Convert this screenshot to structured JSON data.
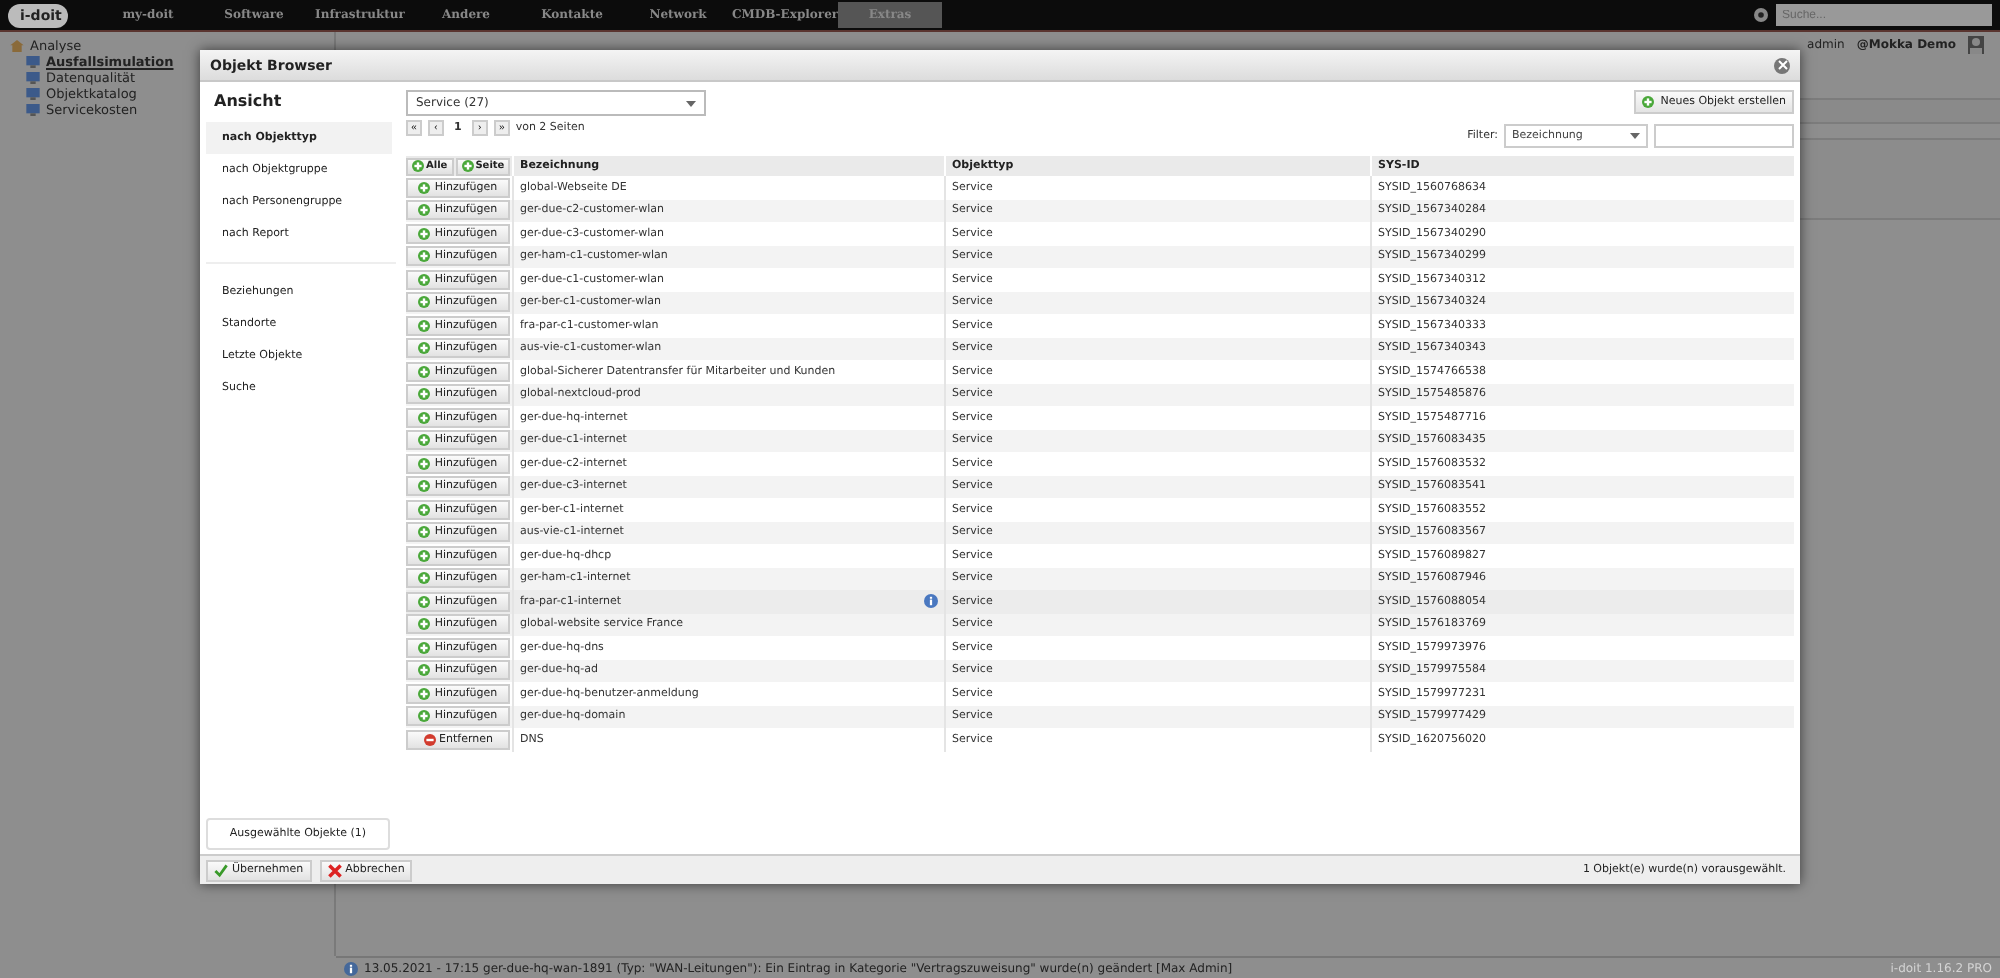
{
  "nav": {
    "logo": "i-doit",
    "items": [
      {
        "label": "my-doit",
        "selected": false
      },
      {
        "label": "Software",
        "selected": false
      },
      {
        "label": "Infrastruktur",
        "selected": false
      },
      {
        "label": "Andere",
        "selected": false
      },
      {
        "label": "Kontakte",
        "selected": false
      },
      {
        "label": "Network",
        "selected": false
      },
      {
        "label": "CMDB-Explorer",
        "selected": false
      },
      {
        "label": "Extras",
        "selected": true
      }
    ],
    "search": {
      "placeholder": "Suche..."
    }
  },
  "user": {
    "name": "admin",
    "tenant": "@Mokka Demo"
  },
  "tree": {
    "items": [
      {
        "label": "Analyse",
        "selected": false,
        "children": [
          {
            "label": "Ausfallsimulation",
            "selected": true
          },
          {
            "label": "Datenqualität",
            "selected": false
          },
          {
            "label": "Objektkatalog",
            "selected": false
          },
          {
            "label": "Servicekosten",
            "selected": false
          }
        ]
      }
    ]
  },
  "dialog": {
    "title": "Objekt Browser",
    "sidebar": {
      "title": "Ansicht",
      "views": [
        {
          "label": "nach Objekttyp",
          "selected": true
        },
        {
          "label": "nach Objektgruppe",
          "selected": false
        },
        {
          "label": "nach Personengruppe",
          "selected": false
        },
        {
          "label": "nach Report",
          "selected": false
        }
      ],
      "links": [
        "Beziehungen",
        "Standorte",
        "Letzte Objekte",
        "Suche"
      ],
      "selected_button": "Ausgewählte Objekte (1)"
    },
    "type_select": "Service (27)",
    "pagination": {
      "first": "«",
      "prev": "‹",
      "page": "1",
      "next": "›",
      "last": "»",
      "pages_text": "von 2 Seiten"
    },
    "new_button": "Neues Objekt erstellen",
    "filter": {
      "label": "Filter:",
      "field": "Bezeichnung"
    },
    "table": {
      "header_buttons": [
        "Alle",
        "Seite"
      ],
      "columns": [
        "Bezeichnung",
        "Objekttyp",
        "SYS-ID"
      ],
      "rows": [
        {
          "action": {
            "kind": "add",
            "label": "Hinzufügen"
          },
          "name": "global-Webseite DE",
          "info": false,
          "type": "Service",
          "sysid": "SYSID_1560768634"
        },
        {
          "action": {
            "kind": "add",
            "label": "Hinzufügen"
          },
          "name": "ger-due-c2-customer-wlan",
          "info": false,
          "type": "Service",
          "sysid": "SYSID_1567340284"
        },
        {
          "action": {
            "kind": "add",
            "label": "Hinzufügen"
          },
          "name": "ger-due-c3-customer-wlan",
          "info": false,
          "type": "Service",
          "sysid": "SYSID_1567340290"
        },
        {
          "action": {
            "kind": "add",
            "label": "Hinzufügen"
          },
          "name": "ger-ham-c1-customer-wlan",
          "info": false,
          "type": "Service",
          "sysid": "SYSID_1567340299"
        },
        {
          "action": {
            "kind": "add",
            "label": "Hinzufügen"
          },
          "name": "ger-due-c1-customer-wlan",
          "info": false,
          "type": "Service",
          "sysid": "SYSID_1567340312"
        },
        {
          "action": {
            "kind": "add",
            "label": "Hinzufügen"
          },
          "name": "ger-ber-c1-customer-wlan",
          "info": false,
          "type": "Service",
          "sysid": "SYSID_1567340324"
        },
        {
          "action": {
            "kind": "add",
            "label": "Hinzufügen"
          },
          "name": "fra-par-c1-customer-wlan",
          "info": false,
          "type": "Service",
          "sysid": "SYSID_1567340333"
        },
        {
          "action": {
            "kind": "add",
            "label": "Hinzufügen"
          },
          "name": "aus-vie-c1-customer-wlan",
          "info": false,
          "type": "Service",
          "sysid": "SYSID_1567340343"
        },
        {
          "action": {
            "kind": "add",
            "label": "Hinzufügen"
          },
          "name": "global-Sicherer Datentransfer für Mitarbeiter und Kunden",
          "info": false,
          "type": "Service",
          "sysid": "SYSID_1574766538"
        },
        {
          "action": {
            "kind": "add",
            "label": "Hinzufügen"
          },
          "name": "global-nextcloud-prod",
          "info": false,
          "type": "Service",
          "sysid": "SYSID_1575485876"
        },
        {
          "action": {
            "kind": "add",
            "label": "Hinzufügen"
          },
          "name": "ger-due-hq-internet",
          "info": false,
          "type": "Service",
          "sysid": "SYSID_1575487716"
        },
        {
          "action": {
            "kind": "add",
            "label": "Hinzufügen"
          },
          "name": "ger-due-c1-internet",
          "info": false,
          "type": "Service",
          "sysid": "SYSID_1576083435"
        },
        {
          "action": {
            "kind": "add",
            "label": "Hinzufügen"
          },
          "name": "ger-due-c2-internet",
          "info": false,
          "type": "Service",
          "sysid": "SYSID_1576083532"
        },
        {
          "action": {
            "kind": "add",
            "label": "Hinzufügen"
          },
          "name": "ger-due-c3-internet",
          "info": false,
          "type": "Service",
          "sysid": "SYSID_1576083541"
        },
        {
          "action": {
            "kind": "add",
            "label": "Hinzufügen"
          },
          "name": "ger-ber-c1-internet",
          "info": false,
          "type": "Service",
          "sysid": "SYSID_1576083552"
        },
        {
          "action": {
            "kind": "add",
            "label": "Hinzufügen"
          },
          "name": "aus-vie-c1-internet",
          "info": false,
          "type": "Service",
          "sysid": "SYSID_1576083567"
        },
        {
          "action": {
            "kind": "add",
            "label": "Hinzufügen"
          },
          "name": "ger-due-hq-dhcp",
          "info": false,
          "type": "Service",
          "sysid": "SYSID_1576089827"
        },
        {
          "action": {
            "kind": "add",
            "label": "Hinzufügen"
          },
          "name": "ger-ham-c1-internet",
          "info": false,
          "type": "Service",
          "sysid": "SYSID_1576087946"
        },
        {
          "action": {
            "kind": "add",
            "label": "Hinzufügen"
          },
          "name": "fra-par-c1-internet",
          "info": true,
          "type": "Service",
          "sysid": "SYSID_1576088054"
        },
        {
          "action": {
            "kind": "add",
            "label": "Hinzufügen"
          },
          "name": "global-website service France",
          "info": false,
          "type": "Service",
          "sysid": "SYSID_1576183769"
        },
        {
          "action": {
            "kind": "add",
            "label": "Hinzufügen"
          },
          "name": "ger-due-hq-dns",
          "info": false,
          "type": "Service",
          "sysid": "SYSID_1579973976"
        },
        {
          "action": {
            "kind": "add",
            "label": "Hinzufügen"
          },
          "name": "ger-due-hq-ad",
          "info": false,
          "type": "Service",
          "sysid": "SYSID_1579975584"
        },
        {
          "action": {
            "kind": "add",
            "label": "Hinzufügen"
          },
          "name": "ger-due-hq-benutzer-anmeldung",
          "info": false,
          "type": "Service",
          "sysid": "SYSID_1579977231"
        },
        {
          "action": {
            "kind": "add",
            "label": "Hinzufügen"
          },
          "name": "ger-due-hq-domain",
          "info": false,
          "type": "Service",
          "sysid": "SYSID_1579977429"
        },
        {
          "action": {
            "kind": "remove",
            "label": "Entfernen"
          },
          "name": "DNS",
          "info": false,
          "type": "Service",
          "sysid": "SYSID_1620756020"
        }
      ]
    },
    "footer": {
      "buttons": [
        {
          "kind": "confirm",
          "label": "Übernehmen"
        },
        {
          "kind": "cancel",
          "label": "Abbrechen"
        }
      ],
      "status": "1 Objekt(e) wurde(n) vorausgewählt."
    }
  },
  "status_bar": {
    "message": "13.05.2021 - 17:15 ger-due-hq-wan-1891 (Typ: \"WAN-Leitungen\"): Ein Eintrag in Kategorie \"Vertragszuweisung\" wurde(n) geändert [Max Admin]",
    "version": "i-doit 1.16.2 PRO"
  }
}
